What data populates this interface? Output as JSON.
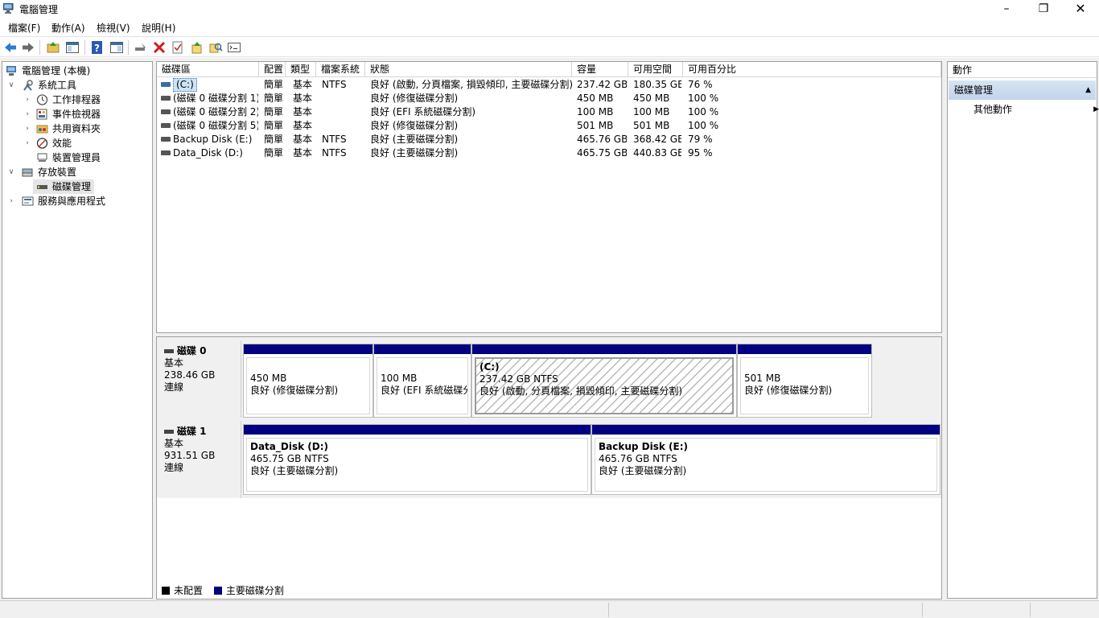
{
  "window": {
    "title": "電腦管理"
  },
  "menu": [
    "檔案(F)",
    "動作(A)",
    "檢視(V)",
    "說明(H)"
  ],
  "tree": {
    "root": "電腦管理 (本機)",
    "system_tools": "系統工具",
    "task_scheduler": "工作排程器",
    "event_viewer": "事件檢視器",
    "shared_folders": "共用資料夾",
    "performance": "效能",
    "device_manager": "裝置管理員",
    "storage": "存放裝置",
    "disk_management": "磁碟管理",
    "services_apps": "服務與應用程式"
  },
  "volume_list": {
    "columns": [
      "磁碟區",
      "配置",
      "類型",
      "檔案系統",
      "狀態",
      "容量",
      "可用空間",
      "可用百分比"
    ],
    "rows": [
      {
        "volume": "(C:)",
        "layout": "簡單",
        "type": "基本",
        "fs": "NTFS",
        "status": "良好 (啟動, 分頁檔案, 損毀傾印, 主要磁碟分割)",
        "capacity": "237.42 GB",
        "free": "180.35 GB",
        "pct": "76 %"
      },
      {
        "volume": "(磁碟 0 磁碟分割 1)",
        "layout": "簡單",
        "type": "基本",
        "fs": "",
        "status": "良好 (修復磁碟分割)",
        "capacity": "450 MB",
        "free": "450 MB",
        "pct": "100 %"
      },
      {
        "volume": "(磁碟 0 磁碟分割 2)",
        "layout": "簡單",
        "type": "基本",
        "fs": "",
        "status": "良好 (EFI 系統磁碟分割)",
        "capacity": "100 MB",
        "free": "100 MB",
        "pct": "100 %"
      },
      {
        "volume": "(磁碟 0 磁碟分割 5)",
        "layout": "簡單",
        "type": "基本",
        "fs": "",
        "status": "良好 (修復磁碟分割)",
        "capacity": "501 MB",
        "free": "501 MB",
        "pct": "100 %"
      },
      {
        "volume": "Backup Disk (E:)",
        "layout": "簡單",
        "type": "基本",
        "fs": "NTFS",
        "status": "良好 (主要磁碟分割)",
        "capacity": "465.76 GB",
        "free": "368.42 GB",
        "pct": "79 %"
      },
      {
        "volume": "Data_Disk (D:)",
        "layout": "簡單",
        "type": "基本",
        "fs": "NTFS",
        "status": "良好 (主要磁碟分割)",
        "capacity": "465.75 GB",
        "free": "440.83 GB",
        "pct": "95 %"
      }
    ]
  },
  "disks": [
    {
      "name": "磁碟 0",
      "type": "基本",
      "size": "238.46 GB",
      "state": "連線",
      "partitions": [
        {
          "line1": "450 MB",
          "line2": "良好 (修復磁碟分割)"
        },
        {
          "line1": "100 MB",
          "line2": "良好 (EFI 系統磁碟分"
        },
        {
          "title": "(C:)",
          "line1": "237.42 GB NTFS",
          "line2": "良好 (啟動, 分頁檔案, 損毀傾印, 主要磁碟分割)"
        },
        {
          "line1": "501 MB",
          "line2": "良好 (修復磁碟分割)"
        }
      ]
    },
    {
      "name": "磁碟 1",
      "type": "基本",
      "size": "931.51 GB",
      "state": "連線",
      "partitions": [
        {
          "title": "Data_Disk  (D:)",
          "line1": "465.75 GB NTFS",
          "line2": "良好 (主要磁碟分割)"
        },
        {
          "title": "Backup Disk  (E:)",
          "line1": "465.76 GB NTFS",
          "line2": "良好 (主要磁碟分割)"
        }
      ]
    }
  ],
  "legend": {
    "unallocated": "未配置",
    "primary": "主要磁碟分割",
    "unallocated_color": "#000000",
    "primary_color": "#000080"
  },
  "actions": {
    "header": "動作",
    "section": "磁碟管理",
    "more": "其他動作"
  }
}
